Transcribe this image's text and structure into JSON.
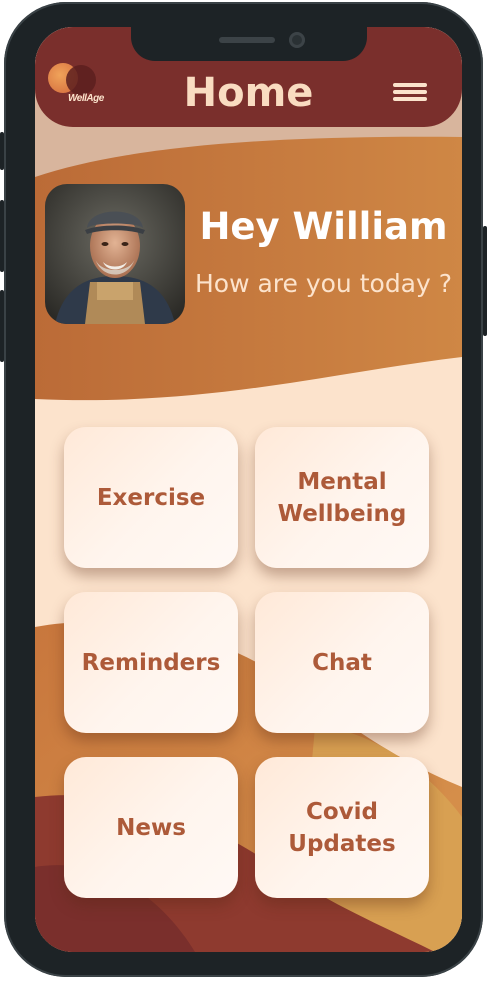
{
  "header": {
    "logo_text": "WellAge",
    "title": "Home",
    "menu_icon": "hamburger-menu-icon"
  },
  "profile": {
    "greeting": "Hey William",
    "subtitle": "How are you today ?"
  },
  "tiles": [
    {
      "label": "Exercise"
    },
    {
      "label": "Mental\nWellbeing"
    },
    {
      "label": "Reminders"
    },
    {
      "label": "Chat"
    },
    {
      "label": "News"
    },
    {
      "label": "Covid Updates"
    }
  ],
  "colors": {
    "header_bg": "#7a2f2c",
    "accent_orange": "#c97a3e",
    "background_peach": "#fce3cc",
    "tile_text": "#ad5a39",
    "title_text": "#f9dcc1"
  }
}
